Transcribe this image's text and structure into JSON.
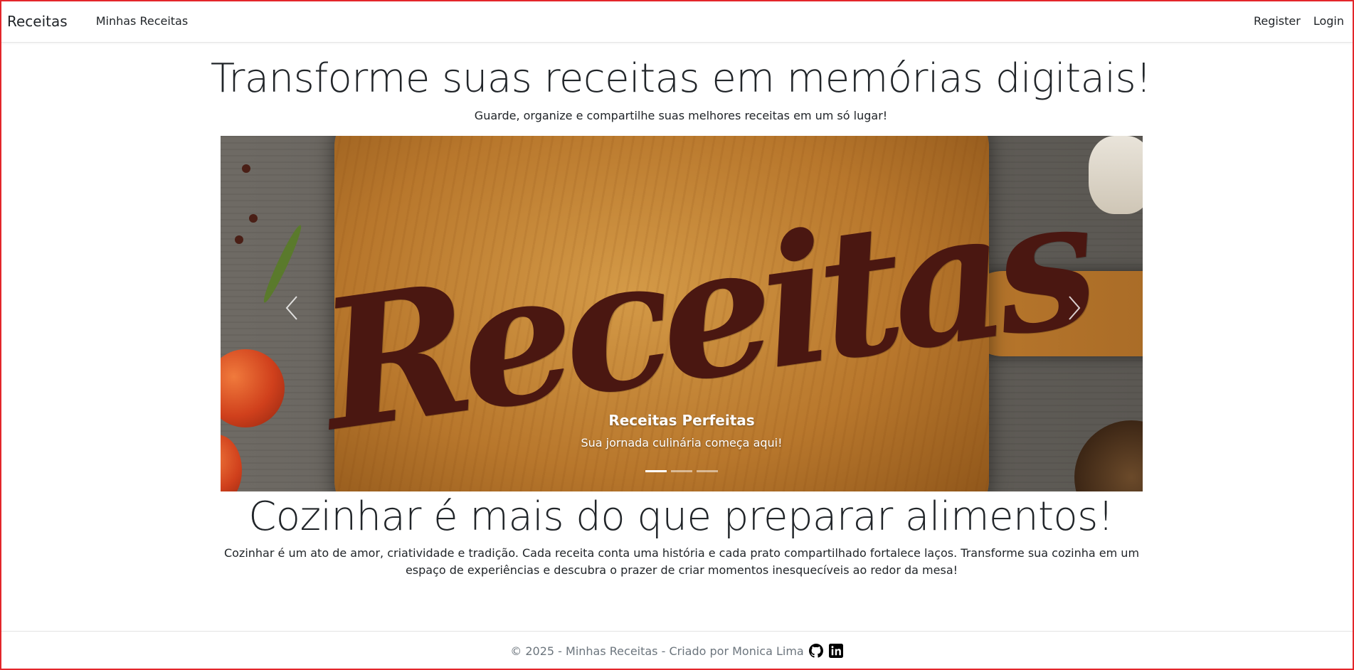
{
  "navbar": {
    "brand": "Receitas",
    "links": [
      "Minhas Receitas"
    ],
    "right_links": [
      "Register",
      "Login"
    ]
  },
  "hero": {
    "title": "Transforme suas receitas em memórias digitais!",
    "subtitle": "Guarde, organize e compartilhe suas melhores receitas em um só lugar!"
  },
  "carousel": {
    "image_text": "Receitas",
    "caption_title": "Receitas Perfeitas",
    "caption_text": "Sua jornada culinária começa aqui!",
    "prev_icon": "chevron-left-icon",
    "next_icon": "chevron-right-icon",
    "slide_count": 3,
    "active_index": 0
  },
  "section": {
    "title": "Cozinhar é mais do que preparar alimentos!",
    "text": "Cozinhar é um ato de amor, criatividade e tradição. Cada receita conta uma história e cada prato compartilhado fortalece laços. Transforme sua cozinha em um espaço de experiências e descubra o prazer de criar momentos inesquecíveis ao redor da mesa!"
  },
  "footer": {
    "text": "© 2025 - Minhas Receitas - Criado por Monica Lima",
    "icons": [
      "github-icon",
      "linkedin-icon"
    ]
  },
  "colors": {
    "frame_border": "#e3262a",
    "script_text": "#4a1711",
    "footer_text": "#6c757d"
  }
}
